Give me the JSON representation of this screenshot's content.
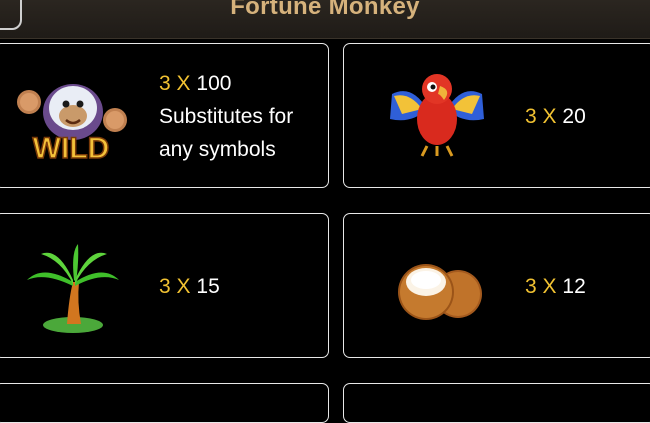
{
  "header": {
    "title": "Fortune Monkey"
  },
  "paytable": [
    {
      "symbol": "wild-monkey",
      "icon_text": "WILD",
      "count": "3",
      "multiplier_sign": "X",
      "payout": "100",
      "description_lines": [
        "Substitutes for",
        "any symbols"
      ]
    },
    {
      "symbol": "parrot",
      "count": "3",
      "multiplier_sign": "X",
      "payout": "20"
    },
    {
      "symbol": "palm-tree",
      "count": "3",
      "multiplier_sign": "X",
      "payout": "15"
    },
    {
      "symbol": "coconut",
      "count": "3",
      "multiplier_sign": "X",
      "payout": "12"
    }
  ],
  "colors": {
    "accent": "#f1c232",
    "title": "#d6b27c",
    "card_border": "#e8e8e8",
    "background": "#000000"
  }
}
